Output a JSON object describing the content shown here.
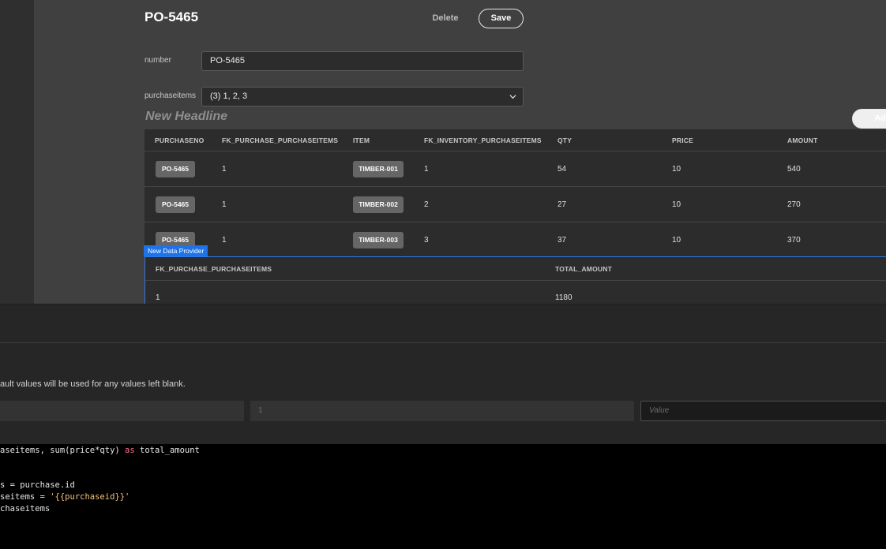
{
  "page": {
    "title": "PO-5465",
    "delete_label": "Delete",
    "save_label": "Save",
    "add_label": "Add",
    "headline": "New Headline"
  },
  "fields": {
    "number": {
      "label": "number",
      "value": "PO-5465"
    },
    "purchaseitems": {
      "label": "purchaseitems",
      "value": "(3) 1, 2, 3"
    }
  },
  "table1": {
    "headers": [
      "PURCHASENO",
      "FK_PURCHASE_PURCHASEITEMS",
      "ITEM",
      "FK_INVENTORY_PURCHASEITEMS",
      "QTY",
      "PRICE",
      "AMOUNT"
    ],
    "rows": [
      [
        "PO-5465",
        "1",
        "TIMBER-001",
        "1",
        "54",
        "10",
        "540"
      ],
      [
        "PO-5465",
        "1",
        "TIMBER-002",
        "2",
        "27",
        "10",
        "270"
      ],
      [
        "PO-5465",
        "1",
        "TIMBER-003",
        "3",
        "37",
        "10",
        "370"
      ]
    ]
  },
  "data_provider": {
    "tag": "New Data Provider",
    "headers": [
      "FK_PURCHASE_PURCHASEITEMS",
      "TOTAL_AMOUNT"
    ],
    "row": [
      "1",
      "1180"
    ]
  },
  "params": {
    "hint": "ault values will be used for any values left blank.",
    "default_value": "1",
    "value_placeholder": "Value"
  },
  "code": {
    "line1_a": "aseitems, sum(price*qty) ",
    "line1_kw": "as",
    "line1_b": " total_amount",
    "line2": "s = purchase.id",
    "line3_a": "seitems = ",
    "line3_str": "'{{purchaseid}}'",
    "line4": "chaseitems"
  }
}
